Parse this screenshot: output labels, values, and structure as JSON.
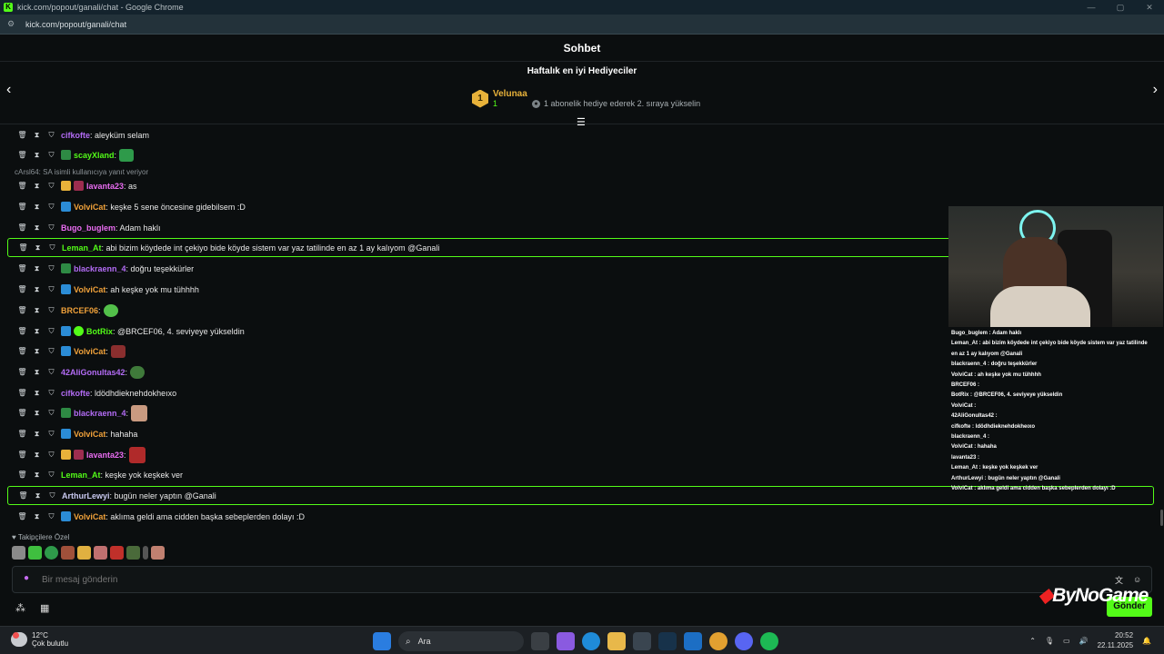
{
  "browser": {
    "window_title": "kick.com/popout/ganali/chat - Google Chrome",
    "url": "kick.com/popout/ganali/chat"
  },
  "chat": {
    "header": "Sohbet",
    "gifters_title": "Haftalık en iyi Hediyeciler",
    "top_gifter": {
      "rank": "1",
      "name": "Velunaa",
      "count": "1"
    },
    "gift_hint": "1 abonelik hediye ederek 2. sıraya yükselin",
    "reply_line": "cArsl64: SA isimli kullanıcıya yanıt veriyor",
    "messages": [
      {
        "user": "cifkofte",
        "text": ": aleyküm selam",
        "color": "#b36cf5"
      },
      {
        "user": "scayXland",
        "text": ":",
        "color": "#53fc18"
      },
      {
        "user": "lavanta23",
        "text": ": as",
        "color": "#e86cf0"
      },
      {
        "user": "VolviCat",
        "text": ": keşke 5 sene öncesine gidebilsem :D",
        "color": "#f0a13a"
      },
      {
        "user": "Bugo_buglem",
        "text": ": Adam haklı",
        "color": "#e86cf0"
      },
      {
        "user": "Leman_At",
        "text": ": abi bizim köydede int çekiyo bide köyde sistem var yaz tatilinde en az 1 ay kalıyom @Ganali",
        "color": "#53fc18"
      },
      {
        "user": "blackraenn_4",
        "text": ": doğru teşekkürler",
        "color": "#b36cf5"
      },
      {
        "user": "VolviCat",
        "text": ": ah keşke yok mu tühhhh",
        "color": "#f0a13a"
      },
      {
        "user": "BRCEF06",
        "text": ":",
        "color": "#f0a13a"
      },
      {
        "user": "BotRix",
        "text": ": @BRCEF06, 4. seviyeye yükseldin",
        "color": "#53fc18"
      },
      {
        "user": "VolviCat",
        "text": ":",
        "color": "#f0a13a"
      },
      {
        "user": "42AliGonultas42",
        "text": ":",
        "color": "#b36cf5"
      },
      {
        "user": "cifkofte",
        "text": ": ldödhdieknehdokheıxo",
        "color": "#b36cf5"
      },
      {
        "user": "blackraenn_4",
        "text": ":",
        "color": "#b36cf5"
      },
      {
        "user": "VolviCat",
        "text": ": hahaha",
        "color": "#f0a13a"
      },
      {
        "user": "lavanta23",
        "text": ":",
        "color": "#e86cf0"
      },
      {
        "user": "Leman_At",
        "text": ": keşke yok keşkek ver",
        "color": "#53fc18"
      },
      {
        "user": "ArthurLewyi",
        "text": ": bugün neler yaptın @Ganali",
        "color": "#c9c9f0"
      },
      {
        "user": "VolviCat",
        "text": ": aklıma geldi ama cidden başka sebeplerden dolayı :D",
        "color": "#f0a13a"
      }
    ],
    "followers_only": "Takipçilere Özel",
    "input_placeholder": "Bir mesaj gönderin",
    "send_label": "Gönder"
  },
  "overlay": {
    "logo": "ByNoGame",
    "lines": [
      "Bugo_buglem : Adam haklı",
      "Leman_At : abi bizim köydede int çekiyo bide köyde sistem var yaz tatilinde",
      "en az 1 ay kalıyom @Ganali",
      "blackraenn_4 : doğru teşekkürler",
      "VolviCat : ah keşke yok mu tühhhh",
      "BRCEF06 :",
      "BotRix : @BRCEF06, 4. seviyeye yükseldin",
      "VolviCat :",
      "42AliGonultas42 :",
      "cifkofte : ldödhdieknehdokheıxo",
      "blackraenn_4 :",
      "VolviCat : hahaha",
      "lavanta23 :",
      "Leman_At : keşke yok keşkek ver",
      "ArthurLewyi : bugün neler yaptın @Ganali",
      "VolviCat : aklıma geldi ama cidden başka sebeplerden dolayı :D"
    ]
  },
  "taskbar": {
    "weather_temp": "12°C",
    "weather_desc": "Çok bulutlu",
    "search_label": "Ara",
    "time": "20:52",
    "date": "22.11.2025"
  }
}
